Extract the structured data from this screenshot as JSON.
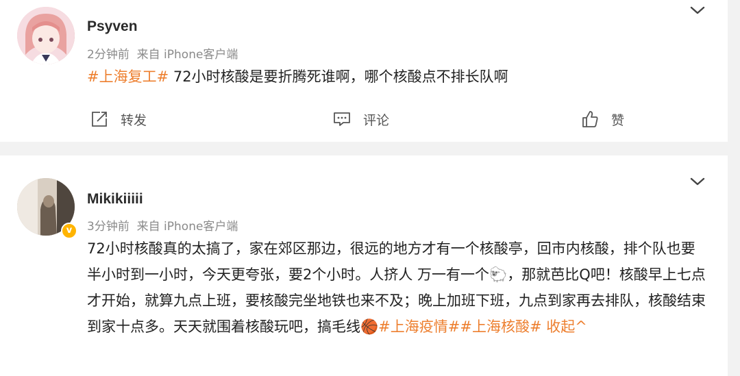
{
  "posts": [
    {
      "username": "Psyven",
      "time": "2分钟前",
      "source": "来自 iPhone客户端",
      "topic": "#上海复工#",
      "text": " 72小时核酸是要折腾死谁啊，哪个核酸点不排长队啊",
      "actions": {
        "repost_label": "转发",
        "comment_label": "评论",
        "like_label": "赞"
      }
    },
    {
      "username": "Mikikiiiii",
      "time": "3分钟前",
      "source": "来自 iPhone客户端",
      "verified_badge": "v",
      "text": "72小时核酸真的太搞了，家在郊区那边，很远的地方才有一个核酸亭，回市内核酸，排个队也要半小时到一小时，今天更夸张，要2个小时。人挤人 万一有一个",
      "text_after_emoji": "，那就芭比Q吧！核酸早上七点才开始，就算九点上班，要核酸完坐地铁也来不及；晚上加班下班，九点到家再去排队，核酸结束到家十点多。天天就围着核酸玩吧，搞毛线",
      "emoji_1": "🐑",
      "emoji_2": "🏀",
      "topic_1": "#上海疫情#",
      "topic_2": "#上海核酸#",
      "collapse_label": " 收起",
      "collapse_arrow": "^"
    }
  ],
  "icons": {
    "chevron": "chevron-down-icon",
    "repost": "repost-icon",
    "comment": "comment-icon",
    "like": "like-icon"
  },
  "colors": {
    "topic": "#ed7f2f",
    "background": "#f2f2f2",
    "card": "#ffffff",
    "verified": "#ffb400"
  }
}
